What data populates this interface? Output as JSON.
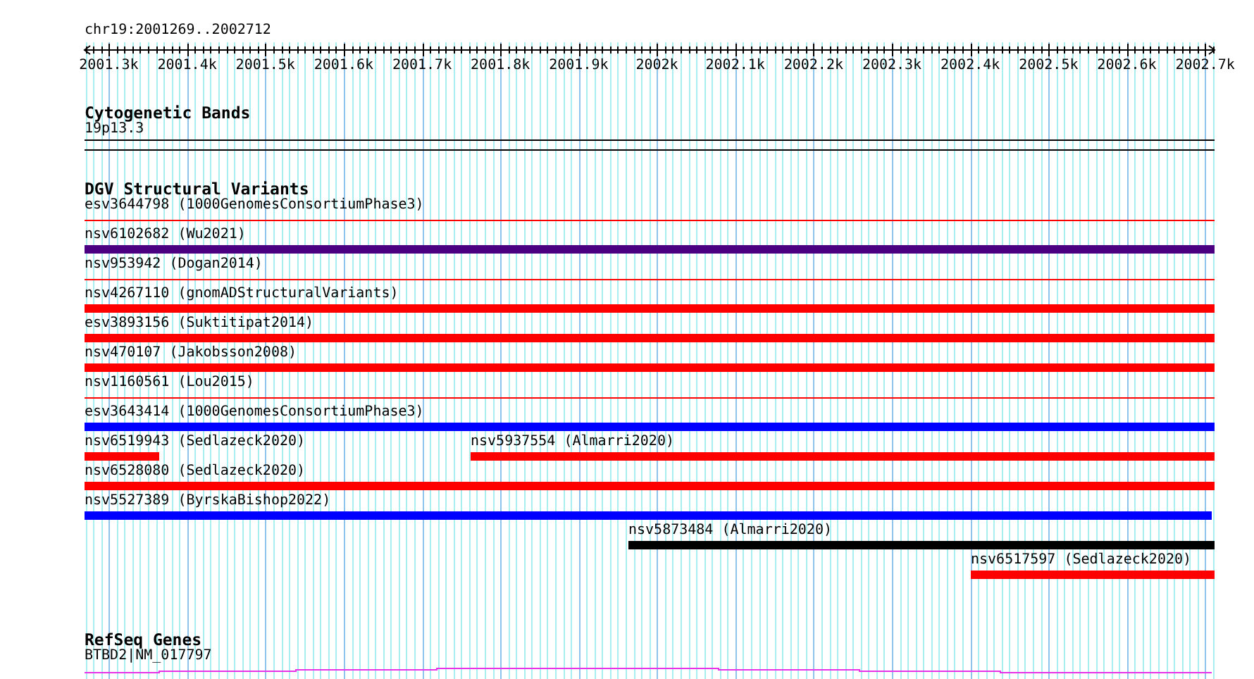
{
  "region": "chr19:2001269..2002712",
  "ruler": {
    "ticks": [
      "2001.3k",
      "2001.4k",
      "2001.5k",
      "2001.6k",
      "2001.7k",
      "2001.8k",
      "2001.9k",
      "2002k",
      "2002.1k",
      "2002.2k",
      "2002.3k",
      "2002.4k",
      "2002.5k",
      "2002.6k",
      "2002.7k"
    ]
  },
  "tracks": [
    {
      "kind": "cytoband",
      "title": "Cytogenetic Bands",
      "band": "19p13.3"
    },
    {
      "kind": "variants",
      "title": "DGV Structural Variants",
      "rows": [
        {
          "features": [
            {
              "label": "esv3644798 (1000GenomesConsortiumPhase3)",
              "kind": "line",
              "color": "#ff0000"
            }
          ]
        },
        {
          "features": [
            {
              "label": "nsv6102682 (Wu2021)",
              "kind": "bar",
              "color": "#4b0082"
            }
          ]
        },
        {
          "features": [
            {
              "label": "nsv953942 (Dogan2014)",
              "kind": "line",
              "color": "#ff0000"
            }
          ]
        },
        {
          "features": [
            {
              "label": "nsv4267110 (gnomADStructuralVariants)",
              "kind": "bar",
              "color": "#ff0000"
            }
          ]
        },
        {
          "features": [
            {
              "label": "esv3893156 (Suktitipat2014)",
              "kind": "bar",
              "color": "#ff0000"
            }
          ]
        },
        {
          "features": [
            {
              "label": "nsv470107 (Jakobsson2008)",
              "kind": "bar",
              "color": "#ff0000"
            }
          ]
        },
        {
          "features": [
            {
              "label": "nsv1160561 (Lou2015)",
              "kind": "line",
              "color": "#ff0000"
            }
          ]
        },
        {
          "features": [
            {
              "label": "esv3643414 (1000GenomesConsortiumPhase3)",
              "kind": "bar",
              "color": "#0000ff"
            }
          ]
        },
        {
          "features": [
            {
              "label": "nsv6519943 (Sedlazeck2020)",
              "kind": "bar",
              "color": "#ff0000"
            },
            {
              "label": "nsv5937554 (Almarri2020)",
              "kind": "bar",
              "color": "#ff0000"
            }
          ]
        },
        {
          "features": [
            {
              "label": "nsv6528080 (Sedlazeck2020)",
              "kind": "bar",
              "color": "#ff0000"
            }
          ]
        },
        {
          "features": [
            {
              "label": "nsv5527389 (ByrskaBishop2022)",
              "kind": "bar",
              "color": "#0000ff"
            }
          ]
        },
        {
          "features": [
            {
              "label": "nsv5873484 (Almarri2020)",
              "kind": "bar",
              "color": "#000000"
            }
          ]
        },
        {
          "features": [
            {
              "label": "nsv6517597 (Sedlazeck2020)",
              "kind": "bar",
              "color": "#ff0000"
            }
          ]
        }
      ]
    },
    {
      "kind": "genes",
      "title": "RefSeq Genes",
      "gene": "BTBD2|NM_017797"
    }
  ]
}
